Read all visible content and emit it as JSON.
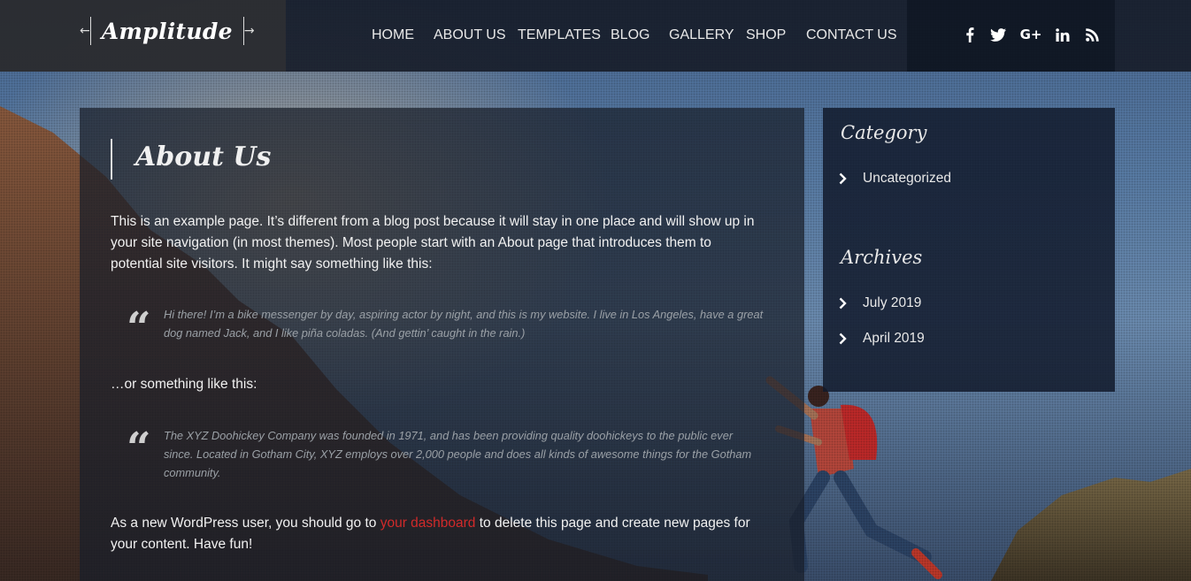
{
  "header": {
    "logo": "Amplitude",
    "nav": [
      {
        "label": "HOME",
        "active": false
      },
      {
        "label": "ABOUT US",
        "active": true
      },
      {
        "label": "TEMPLATES",
        "active": false
      },
      {
        "label": "BLOG",
        "active": false
      },
      {
        "label": "GALLERY",
        "active": false
      },
      {
        "label": "SHOP",
        "active": false
      },
      {
        "label": "CONTACT US",
        "active": false
      }
    ],
    "social": [
      "facebook-icon",
      "twitter-icon",
      "google-plus-icon",
      "linkedin-icon",
      "rss-icon"
    ]
  },
  "main": {
    "title": "About Us",
    "intro": "This is an example page. It’s different from a blog post because it will stay in one place and will show up in your site navigation (in most themes). Most people start with an About page that introduces them to potential site visitors. It might say something like this:",
    "quote1": "Hi there! I’m a bike messenger by day, aspiring actor by night, and this is my website. I live in Los Angeles, have a great dog named Jack, and I like piña coladas. (And gettin’ caught in the rain.)",
    "or_text": "…or something like this:",
    "quote2": "The XYZ Doohickey Company was founded in 1971, and has been providing quality doohickeys to the public ever since. Located in Gotham City, XYZ employs over 2,000 people and does all kinds of awesome things for the Gotham community.",
    "outro_before": "As a new WordPress user, you should go to ",
    "outro_link": "your dashboard",
    "outro_after": " to delete this page and create new pages for your content. Have fun!"
  },
  "sidebar": {
    "category_title": "Category",
    "categories": [
      "Uncategorized"
    ],
    "archives_title": "Archives",
    "archives": [
      "July 2019",
      "April 2019"
    ]
  },
  "colors": {
    "accent": "#d12a2a",
    "header_bg": "#161c28"
  }
}
